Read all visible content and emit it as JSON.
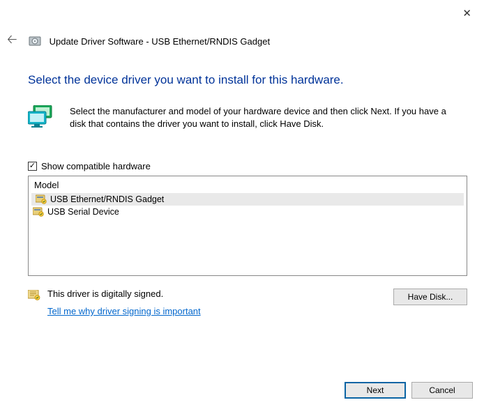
{
  "window": {
    "title": "Update Driver Software - USB Ethernet/RNDIS Gadget"
  },
  "heading": "Select the device driver you want to install for this hardware.",
  "instruction": "Select the manufacturer and model of your hardware device and then click Next. If you have a disk that contains the driver you want to install, click Have Disk.",
  "checkbox_label": "Show compatible hardware",
  "checkbox_checked": "✓",
  "list_header": "Model",
  "models": [
    "USB Ethernet/RNDIS Gadget",
    "USB Serial Device"
  ],
  "signing": {
    "status": "This driver is digitally signed.",
    "link": "Tell me why driver signing is important"
  },
  "buttons": {
    "have_disk": "Have Disk...",
    "next": "Next",
    "cancel": "Cancel"
  }
}
